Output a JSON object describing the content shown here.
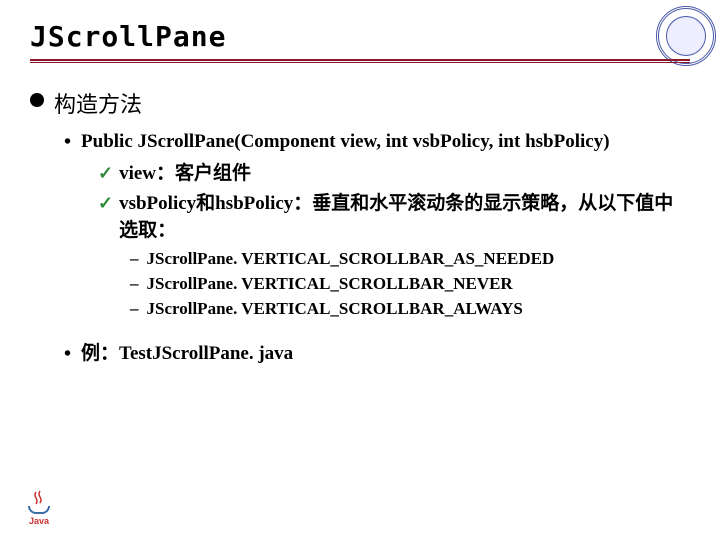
{
  "header": {
    "title": "JScrollPane"
  },
  "level1": {
    "heading": "构造方法"
  },
  "constructor": {
    "signature": "Public JScrollPane(Component view, int vsbPolicy, int hsbPolicy)"
  },
  "params": {
    "view": "view：客户组件",
    "policy": "vsbPolicy和hsbPolicy：垂直和水平滚动条的显示策略，从以下值中选取："
  },
  "constants": {
    "c1": "JScrollPane. VERTICAL_SCROLLBAR_AS_NEEDED",
    "c2": "JScrollPane. VERTICAL_SCROLLBAR_NEVER",
    "c3": "JScrollPane. VERTICAL_SCROLLBAR_ALWAYS"
  },
  "example": {
    "label": "例：TestJScrollPane. java"
  },
  "logo": {
    "text": "Java"
  }
}
